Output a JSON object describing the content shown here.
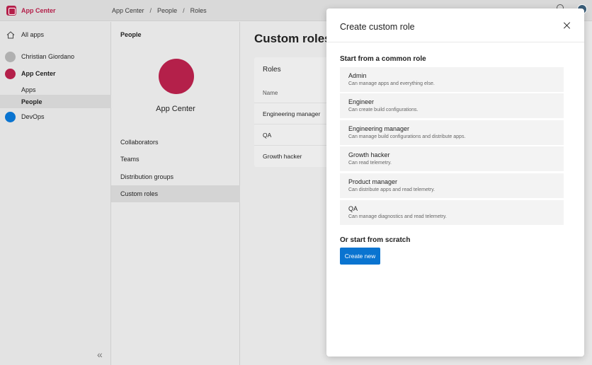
{
  "topbar": {
    "brand": "App Center",
    "breadcrumbs": [
      "App Center",
      "People",
      "Roles"
    ],
    "separator": "/"
  },
  "nav": {
    "all_apps": "All apps",
    "user": "Christian Giordano",
    "org": "App Center",
    "sub_items": [
      "Apps",
      "People"
    ],
    "devops": "DevOps",
    "collapse": "«"
  },
  "people": {
    "title": "People",
    "org_name": "App Center",
    "menu": [
      "Collaborators",
      "Teams",
      "Distribution groups",
      "Custom roles"
    ]
  },
  "main": {
    "heading": "Custom roles",
    "card_title": "Roles",
    "column": "Name",
    "rows": [
      "Engineering manager",
      "QA",
      "Growth hacker"
    ]
  },
  "panel": {
    "title": "Create custom role",
    "common_heading": "Start from a common role",
    "roles": [
      {
        "name": "Admin",
        "desc": "Can manage apps and everything else."
      },
      {
        "name": "Engineer",
        "desc": "Can create build configurations."
      },
      {
        "name": "Engineering manager",
        "desc": "Can manage build configurations and distribute apps."
      },
      {
        "name": "Growth hacker",
        "desc": "Can read telemetry."
      },
      {
        "name": "Product manager",
        "desc": "Can distribute apps and read telemetry."
      },
      {
        "name": "QA",
        "desc": "Can manage diagnostics and read telemetry."
      }
    ],
    "scratch_heading": "Or start from scratch",
    "create_button": "Create new"
  },
  "colors": {
    "brand": "#b4204a",
    "devops": "#0a74d0",
    "user": "#b0b0b0",
    "primary_button": "#0a74d0"
  }
}
